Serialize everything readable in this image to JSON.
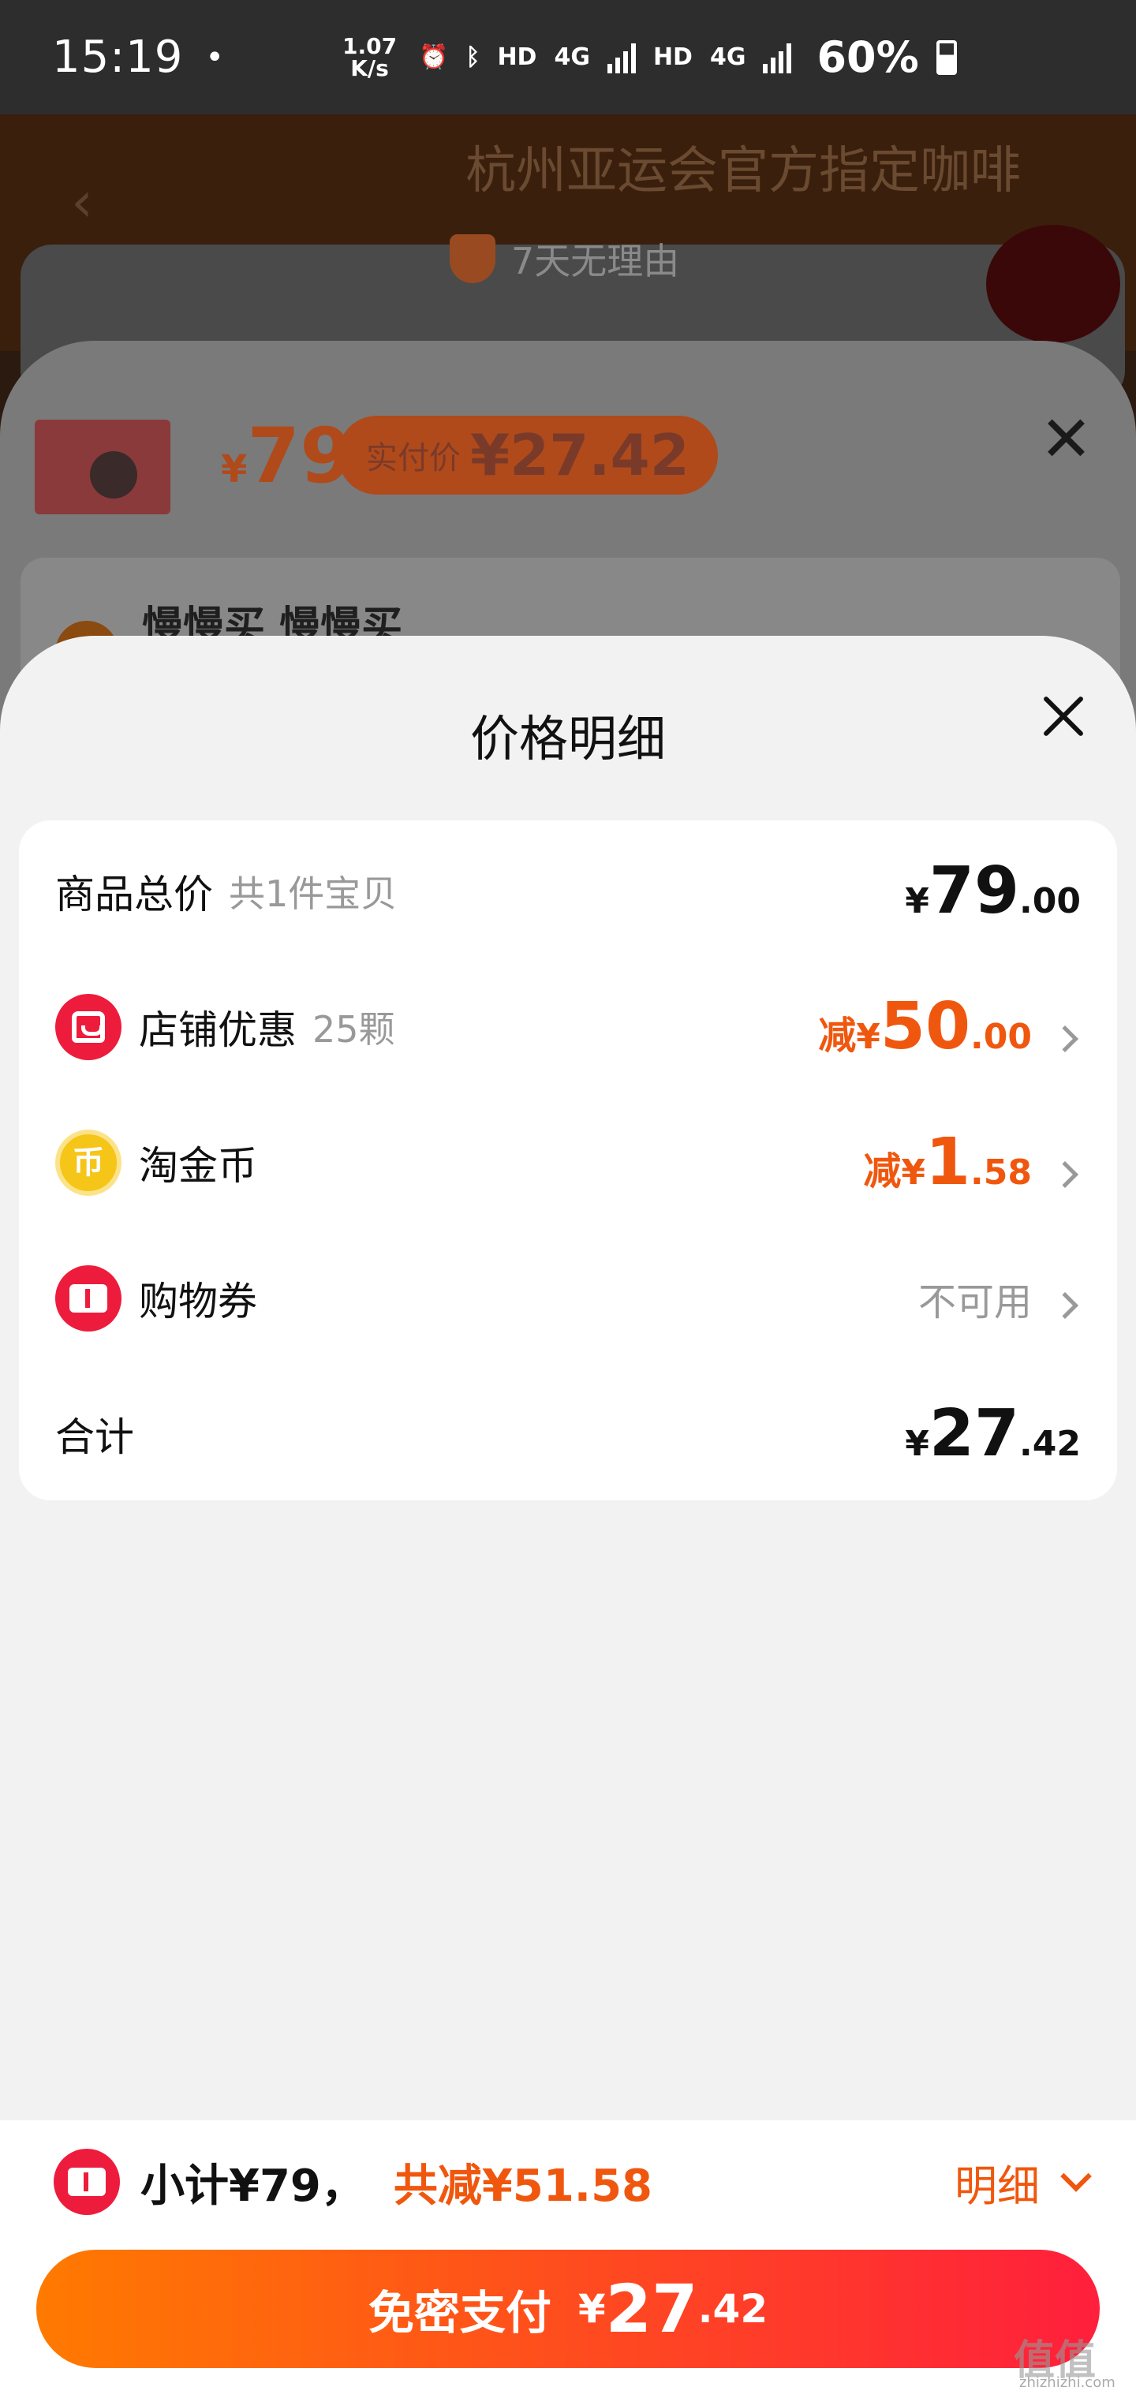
{
  "status_bar": {
    "time": "15:19",
    "dot": "•",
    "speed_value": "1.07",
    "speed_unit": "K/s",
    "hd1": "HD",
    "net1": "4G",
    "hd2": "HD",
    "net2": "4G",
    "battery": "60%"
  },
  "background_page": {
    "title": "杭州亚运会官方指定咖啡",
    "guarantee": "7天无理由"
  },
  "sku_sheet": {
    "currency": "¥",
    "price": "79",
    "pay_label": "实付价",
    "pay_price": "¥27.42",
    "user_name": "慢慢买 慢慢买"
  },
  "price_detail": {
    "title": "价格明细",
    "rows": [
      {
        "label": "商品总价",
        "sub": "共1件宝贝",
        "prefix": "",
        "yen": "¥",
        "int": "79",
        "dec": ".00"
      },
      {
        "label": "店铺优惠",
        "sub": "25颗",
        "prefix": "减",
        "yen": "¥",
        "int": "50",
        "dec": ".00"
      },
      {
        "label": "淘金币",
        "sub": "",
        "prefix": "减",
        "yen": "¥",
        "int": "1",
        "dec": ".58",
        "icon_text": "币"
      },
      {
        "label": "购物券",
        "sub": "",
        "status": "不可用"
      },
      {
        "label": "合计",
        "sub": "",
        "prefix": "",
        "yen": "¥",
        "int": "27",
        "dec": ".42"
      }
    ]
  },
  "bottom_bar": {
    "subtotal": "小计¥79，",
    "discount": "共减¥51.58",
    "detail_link": "明细",
    "pay_label": "免密支付",
    "pay_yen": "¥",
    "pay_int": "27",
    "pay_dec": ".42"
  },
  "watermark": {
    "text": "值值值",
    "sub": "zhizhizhi.com"
  },
  "colors": {
    "accent_orange": "#f0570e",
    "brand_red": "#ee1c3c",
    "gold": "#f5c518"
  }
}
